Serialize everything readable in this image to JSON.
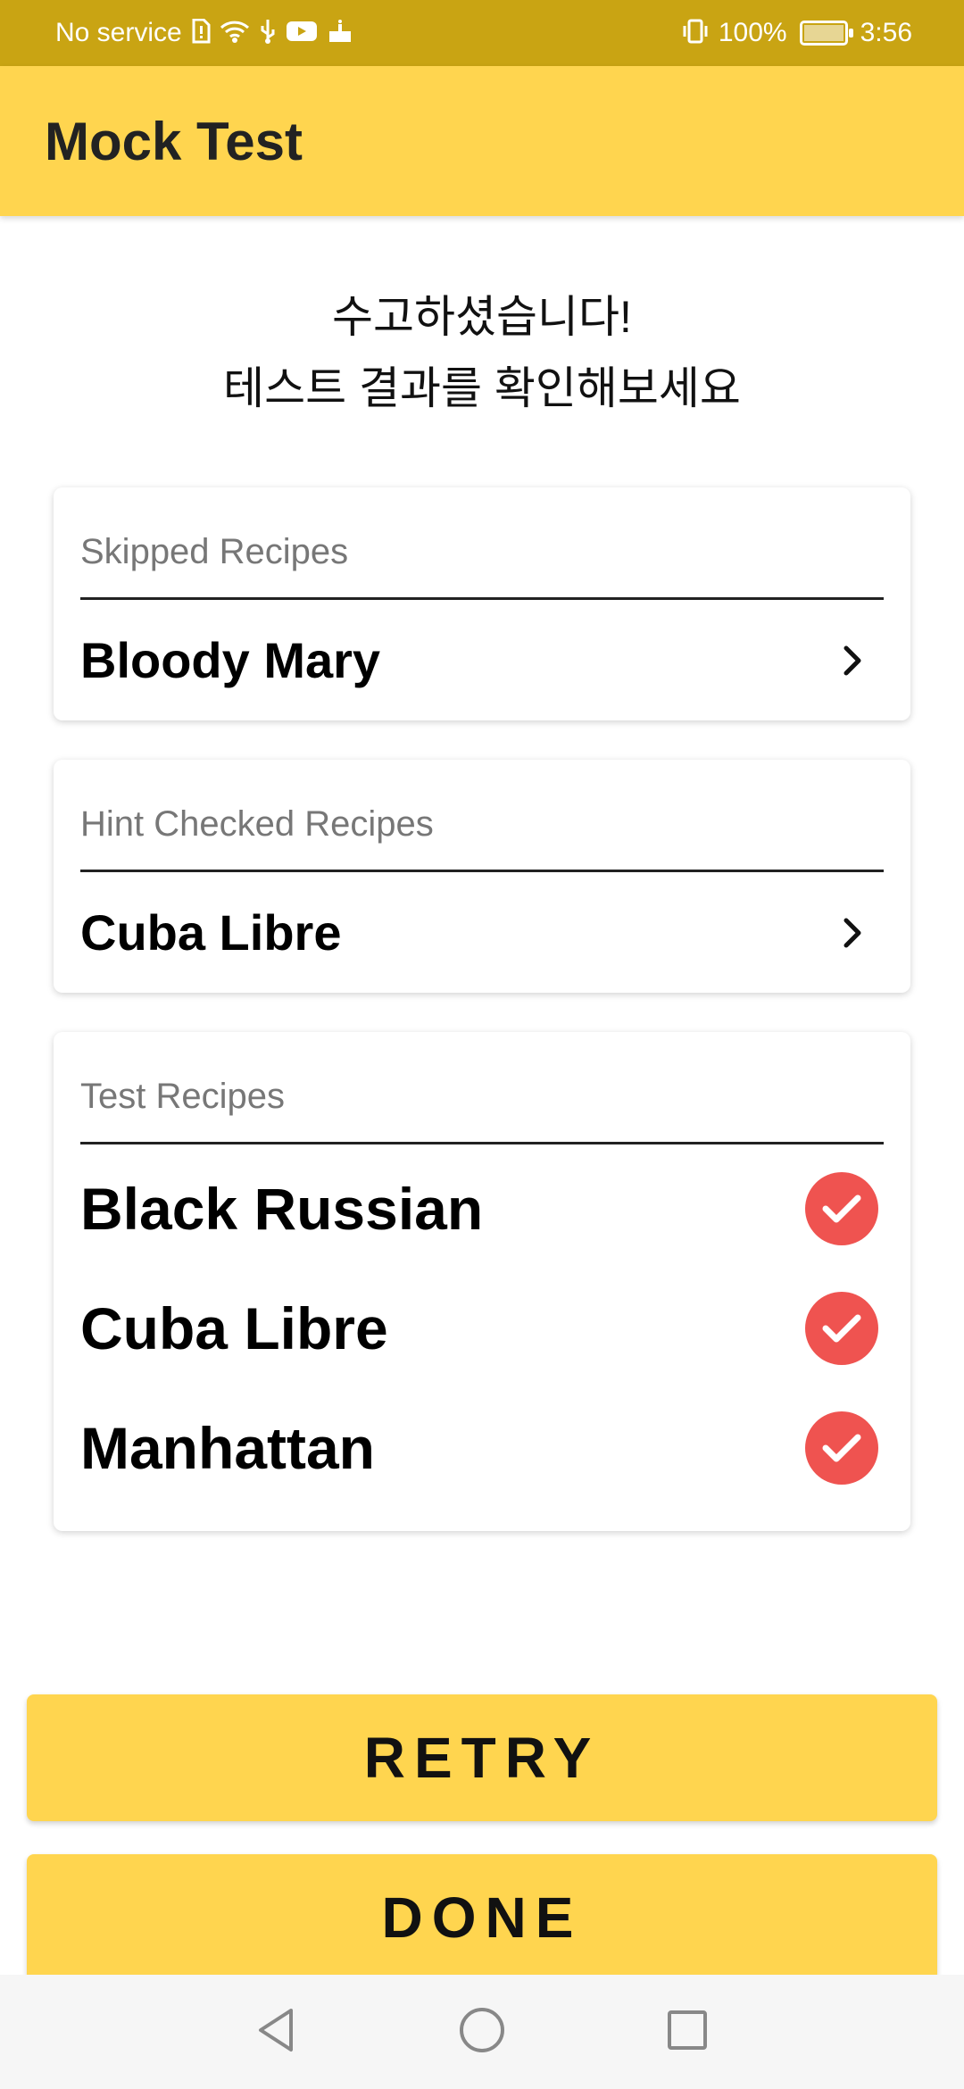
{
  "status_bar": {
    "carrier": "No service",
    "battery_text": "100%",
    "time": "3:56",
    "icons": [
      "sim-alert-icon",
      "wifi-icon",
      "usb-icon",
      "youtube-icon",
      "cake-icon",
      "vibrate-icon",
      "battery-charging-icon"
    ]
  },
  "app_bar": {
    "title": "Mock Test"
  },
  "headline": {
    "line1": "수고하셨습니다!",
    "line2": "테스트 결과를 확인해보세요"
  },
  "sections": {
    "skipped": {
      "title": "Skipped Recipes",
      "items": [
        "Bloody Mary"
      ]
    },
    "hint": {
      "title": "Hint Checked Recipes",
      "items": [
        "Cuba Libre"
      ]
    },
    "test": {
      "title": "Test Recipes",
      "items": [
        "Black Russian",
        "Cuba Libre",
        "Manhattan"
      ]
    }
  },
  "buttons": {
    "retry": "RETRY",
    "done": "DONE"
  },
  "colors": {
    "status_bar": "#C9A413",
    "primary": "#FFD54F",
    "check": "#EF5350"
  }
}
